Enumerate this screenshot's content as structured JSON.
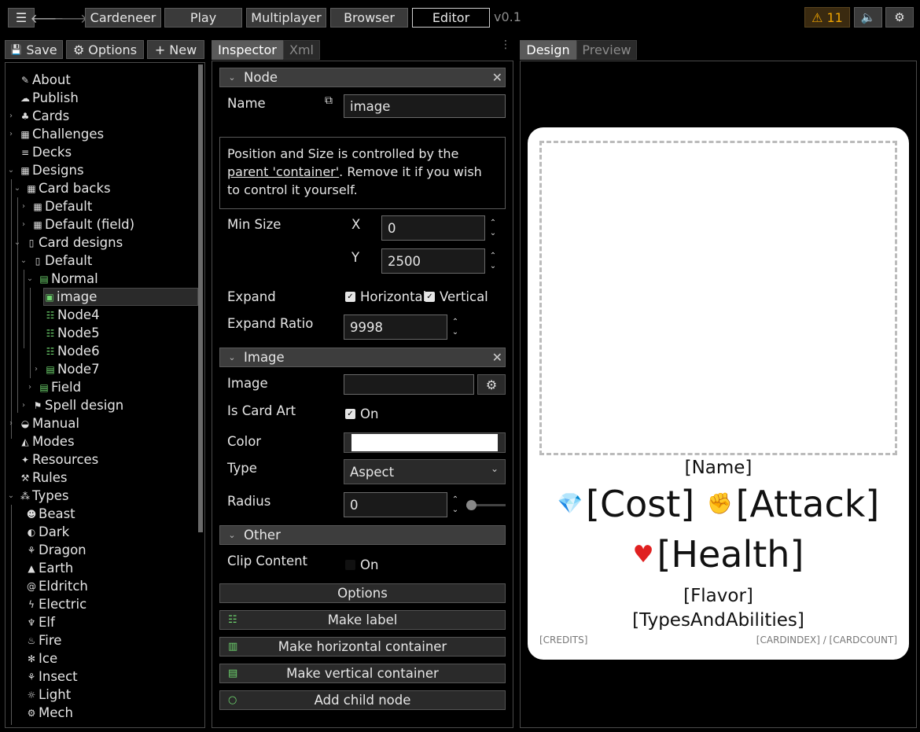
{
  "topbar": {
    "nav": [
      "Cardeneer",
      "Play",
      "Multiplayer",
      "Browser",
      "Editor"
    ],
    "version": "v0.1",
    "warnings": "11"
  },
  "left": {
    "save": "Save",
    "options": "Options",
    "new": "New",
    "tree": [
      {
        "label": "About"
      },
      {
        "label": "Publish"
      },
      {
        "label": "Cards"
      },
      {
        "label": "Challenges"
      },
      {
        "label": "Decks"
      },
      {
        "label": "Designs"
      },
      {
        "label": "Card backs"
      },
      {
        "label": "Default"
      },
      {
        "label": "Default (field)"
      },
      {
        "label": "Card designs"
      },
      {
        "label": "Default"
      },
      {
        "label": "Normal"
      },
      {
        "label": "image"
      },
      {
        "label": "Node4"
      },
      {
        "label": "Node5"
      },
      {
        "label": "Node6"
      },
      {
        "label": "Node7"
      },
      {
        "label": "Field"
      },
      {
        "label": "Spell design"
      },
      {
        "label": "Manual"
      },
      {
        "label": "Modes"
      },
      {
        "label": "Resources"
      },
      {
        "label": "Rules"
      },
      {
        "label": "Types"
      },
      {
        "label": "Beast"
      },
      {
        "label": "Dark"
      },
      {
        "label": "Dragon"
      },
      {
        "label": "Earth"
      },
      {
        "label": "Eldritch"
      },
      {
        "label": "Electric"
      },
      {
        "label": "Elf"
      },
      {
        "label": "Fire"
      },
      {
        "label": "Ice"
      },
      {
        "label": "Insect"
      },
      {
        "label": "Light"
      },
      {
        "label": "Mech"
      }
    ]
  },
  "inspector": {
    "tabs": [
      "Inspector",
      "Xml"
    ],
    "node_section": "Node",
    "name_label": "Name",
    "name_value": "image",
    "note_pre": "Position and Size is controlled by the ",
    "note_link": "parent 'container'",
    "note_post": ". Remove it if you wish to control it yourself.",
    "min_size_label": "Min Size",
    "x_label": "X",
    "x_value": "0",
    "y_label": "Y",
    "y_value": "2500",
    "expand_label": "Expand",
    "horizontal": "Horizontal",
    "vertical": "Vertical",
    "expand_ratio_label": "Expand Ratio",
    "expand_ratio_value": "9998",
    "image_section": "Image",
    "image_label": "Image",
    "is_card_art_label": "Is Card Art",
    "on_label": "On",
    "color_label": "Color",
    "type_label": "Type",
    "type_value": "Aspect",
    "radius_label": "Radius",
    "radius_value": "0",
    "other_section": "Other",
    "clip_label": "Clip Content",
    "clip_on": "On",
    "options_btn": "Options",
    "make_label": "Make label",
    "make_h": "Make horizontal container",
    "make_v": "Make vertical container",
    "add_child": "Add child node"
  },
  "design": {
    "tabs": [
      "Design",
      "Preview"
    ],
    "name": "[Name]",
    "cost": "[Cost]",
    "attack": "[Attack]",
    "health": "[Health]",
    "flavor": "[Flavor]",
    "types": "[TypesAndAbilities]",
    "credits": "[CREDITS]",
    "index": "[CARDINDEX] / [CARDCOUNT]"
  }
}
